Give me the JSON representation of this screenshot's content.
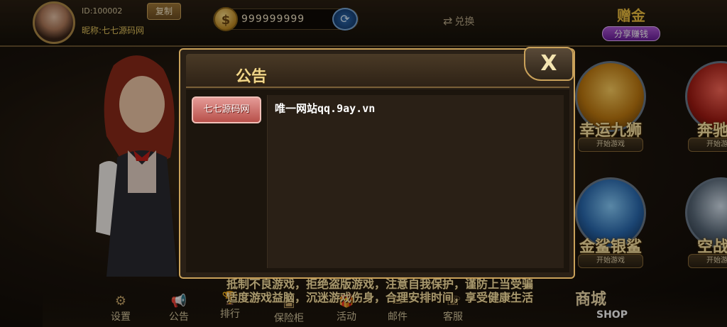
{
  "header": {
    "user_id": "ID:100002",
    "copy_label": "复制",
    "nickname": "昵称:七七源码网",
    "coins": "999999999",
    "exchange_label": "兑换",
    "share_top": "赠金",
    "share_bottom": "分享赚钱"
  },
  "games": [
    {
      "title": "幸运九狮",
      "start": "开始游戏"
    },
    {
      "title": "奔驰宝",
      "start": "开始游戏"
    },
    {
      "title": "金鲨银鲨",
      "start": "开始游戏"
    },
    {
      "title": "空战英",
      "start": "开始游戏"
    }
  ],
  "ticker": {
    "line1": "抵制不良游戏，拒绝盗版游戏，注意自我保护，谨防上当受骗",
    "line2": "适度游戏益脑，沉迷游戏伤身，合理安排时间，享受健康生活"
  },
  "bottom_nav": [
    {
      "label": "设置",
      "icon": "gear-icon"
    },
    {
      "label": "公告",
      "icon": "megaphone-icon"
    },
    {
      "label": "排行",
      "icon": "trophy-icon"
    },
    {
      "label": "保险柜",
      "icon": "safe-icon"
    },
    {
      "label": "活动",
      "icon": "gift-icon"
    },
    {
      "label": "邮件",
      "icon": "mail-icon"
    },
    {
      "label": "客服",
      "icon": "headset-icon"
    }
  ],
  "shop": {
    "main": "商城",
    "sub": "SHOP"
  },
  "modal": {
    "title": "公告",
    "close": "X",
    "tabs": [
      {
        "label": "七七源码网"
      }
    ],
    "content": "唯一网站qq.9ay.vn"
  }
}
